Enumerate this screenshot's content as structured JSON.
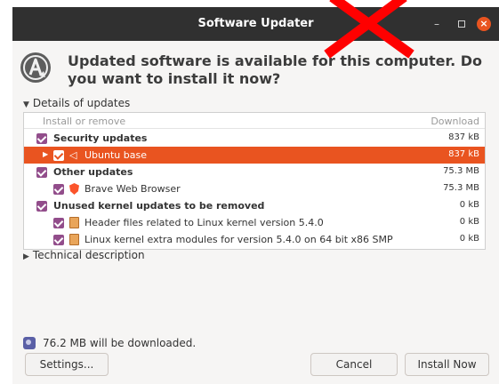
{
  "window": {
    "title": "Software Updater",
    "controls": {
      "minimize": "–",
      "close": "×"
    }
  },
  "header": {
    "message": "Updated software is available for this computer. Do you want to install it now?"
  },
  "details": {
    "expander_label": "Details of updates",
    "columns": {
      "name": "Install or remove",
      "size": "Download"
    },
    "rows": [
      {
        "label": "Security updates",
        "size": "837 kB",
        "kind": "group",
        "checked": true
      },
      {
        "label": "Ubuntu base",
        "size": "837 kB",
        "kind": "item",
        "icon": "speaker-icon",
        "checked": true,
        "selected": true,
        "expandable": true
      },
      {
        "label": "Other updates",
        "size": "75.3 MB",
        "kind": "group",
        "checked": true
      },
      {
        "label": "Brave Web Browser",
        "size": "75.3 MB",
        "kind": "item",
        "icon": "brave-lion-icon",
        "checked": true
      },
      {
        "label": "Unused kernel updates to be removed",
        "size": "0 kB",
        "kind": "group",
        "checked": true
      },
      {
        "label": "Header files related to Linux kernel version 5.4.0",
        "size": "0 kB",
        "kind": "item",
        "icon": "package-icon",
        "checked": true
      },
      {
        "label": "Linux kernel extra modules for version 5.4.0 on 64 bit x86 SMP",
        "size": "0 kB",
        "kind": "item",
        "icon": "package-icon",
        "checked": true
      }
    ]
  },
  "technical": {
    "expander_label": "Technical description"
  },
  "download": {
    "text": "76.2 MB will be downloaded."
  },
  "buttons": {
    "settings": "Settings...",
    "cancel": "Cancel",
    "install": "Install Now"
  },
  "colors": {
    "titlebar": "#303030",
    "selection": "#e95420",
    "checkbox": "#924d8b",
    "overlay_cross": "#ff0000"
  }
}
